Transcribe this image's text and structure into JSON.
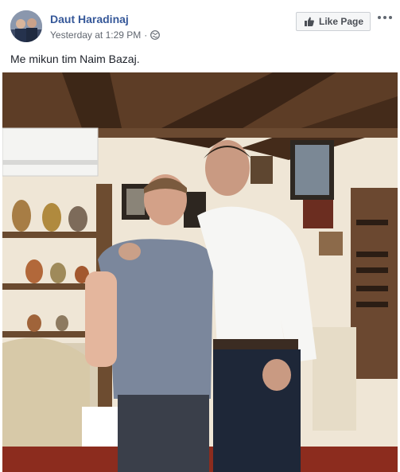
{
  "post": {
    "author_name": "Daut Haradinaj",
    "timestamp": "Yesterday at 1:29 PM",
    "separator": "·",
    "privacy_icon": "globe-icon",
    "caption": "Me mikun tim Naim Bazaj.",
    "like_page_label": "Like Page",
    "more_icon": "more-options-icon"
  },
  "colors": {
    "author_link": "#365899",
    "meta_text": "#616770",
    "button_bg": "#f5f6f7",
    "button_border": "#ccd0d5"
  }
}
